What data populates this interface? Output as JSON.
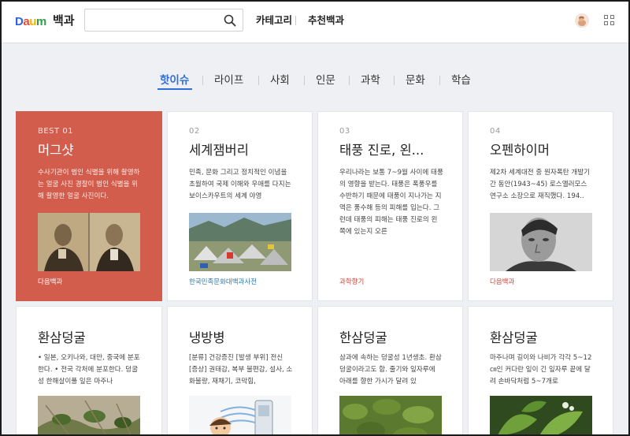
{
  "header": {
    "logo": "Daum",
    "brand_name": "백과",
    "search": {
      "value": "",
      "placeholder": ""
    },
    "nav": [
      "카테고리",
      "추천백과"
    ],
    "icons": {
      "search": "search-icon",
      "profile": "avatar",
      "apps": "app-grid-icon"
    }
  },
  "tabs": {
    "active_index": 0,
    "items": [
      "핫이슈",
      "라이프",
      "사회",
      "인문",
      "과학",
      "문화",
      "학습"
    ]
  },
  "colors": {
    "accent": "#2f6fd8",
    "best_card_bg": "#d35d4d",
    "source_blue": "#2a7ab0",
    "source_red": "#d0463a"
  },
  "cards": [
    {
      "rank": "BEST 01",
      "title": "머그샷",
      "desc": "수사기관이 범인 식별을 위해 촬영하는 얼굴 사진 경찰이 범인 식별을 위해 촬영한 얼굴 사진이다.",
      "source": "다음백과"
    },
    {
      "rank": "02",
      "title": "세계잼버리",
      "desc": "민족, 문화 그리고 정치적인 이념을 초월하여 국제 이해와 우애를 다지는 보이스카우트의 세계 야영",
      "source": "한국민족문화대백과사전"
    },
    {
      "rank": "03",
      "title": "태풍 진로, 왼...",
      "desc": "우리나라는 보통 7~9월 사이에 태풍의 영향을 받는다. 태풍은 폭풍우를 수반하기 때문에 태풍이 지나가는 지역은 풍수해 등의 피해를 입는다. 그런데 태풍의 피해는 태풍 진로의 왼쪽에 있는지 오른",
      "source": "과학향기"
    },
    {
      "rank": "04",
      "title": "오펜하이머",
      "desc": "제2차 세계대전 중 원자폭탄 개발기간 동안(1943~45) 로스앨러모스 연구소 소장으로 재직했다. 194..",
      "source": "다음백과"
    },
    {
      "title": "환삼덩굴",
      "desc": "• 일본, 오키나와, 대만, 중국에 분포한다. • 전국 각처에 분포한다. 덩굴성 한해살이풀 잎은 마주나"
    },
    {
      "title": "냉방병",
      "desc": "[분류] 건강증진 [발생 부위] 전신 [증상] 권태감, 복부 불편감, 설사, 소화불량, 재채기, 코막힘,"
    },
    {
      "title": "한삼덩굴",
      "desc": "삼과에 속하는 덩굴성 1년생초. 환삼덩굴이라고도 함. 줄기와 잎자루에 아래를 향한 가시가 달려 있"
    },
    {
      "title": "환삼덩굴",
      "desc": "마주나며 길이와 나비가 각각 5~12㎝인 커다란 잎이 긴 잎자루 끝에 달려 손바닥처럼 5~7개로"
    }
  ]
}
